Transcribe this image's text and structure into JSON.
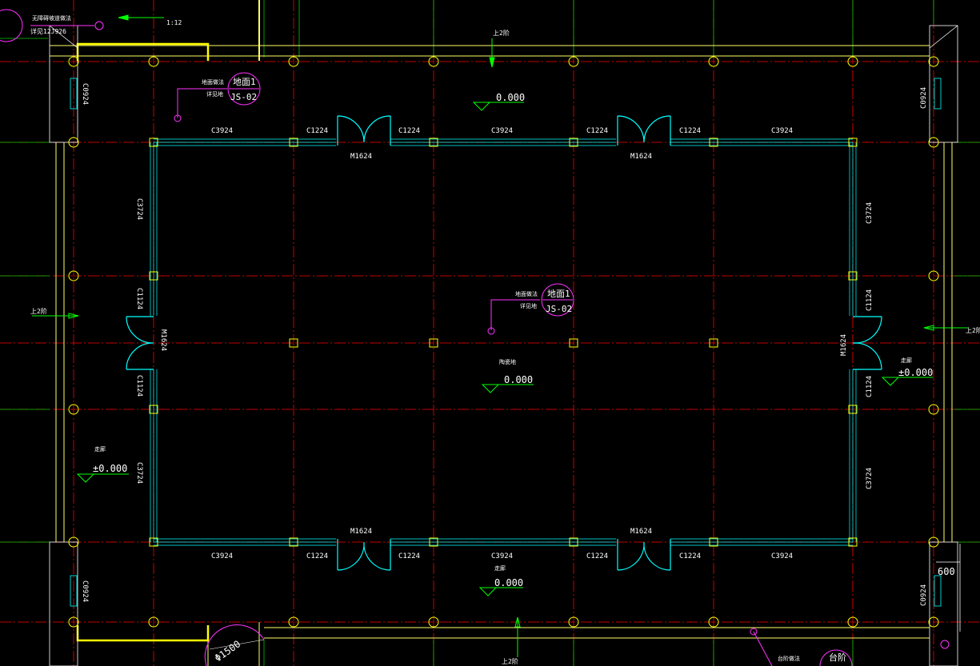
{
  "drawing": {
    "background": "#000000",
    "colors": {
      "axis": "#ff0000",
      "grid_green": "#00c800",
      "wall": "#00ffff",
      "outline": "#ffff66",
      "column": "#ffff00",
      "marker": "#ff33ff",
      "arrow": "#00ff00",
      "white": "#ffffff"
    }
  },
  "top_left_note": {
    "line1": "无障碍坡道做法",
    "line2": "详见12J926",
    "ratio": "1:12"
  },
  "floor_tags": [
    {
      "line1": "地面做法",
      "line2": "详见地",
      "tag": "地面1",
      "code": "JS-02"
    },
    {
      "line1": "地面做法",
      "line2": "详见地",
      "tag": "地面1",
      "code": "JS-02"
    }
  ],
  "level_marks": {
    "top": {
      "label": "",
      "value": "0.000"
    },
    "center": {
      "label": "陶瓷地",
      "value": "0.000"
    },
    "left": {
      "label": "走廊",
      "value": "±0.000"
    },
    "right": {
      "label": "走廊",
      "value": "±0.000"
    },
    "bottom": {
      "label": "走廊",
      "value": "0.000"
    }
  },
  "windows": {
    "top": [
      "C3924",
      "C1224",
      "C1224",
      "C3924",
      "C1224",
      "C1224",
      "C3924"
    ],
    "bottom": [
      "C3924",
      "C1224",
      "C1224",
      "C3924",
      "C1224",
      "C1224",
      "C3924"
    ],
    "left": [
      "C3724",
      "C1124",
      "C1124",
      "C3724"
    ],
    "right": [
      "C3724",
      "C1124",
      "C1124",
      "C3724"
    ],
    "corner": [
      "C0924",
      "C0924",
      "C0924",
      "C0924"
    ]
  },
  "doors": {
    "top": [
      "M1624",
      "M1624"
    ],
    "bottom": [
      "M1624",
      "M1624"
    ],
    "left": "M1624",
    "right": "M1624"
  },
  "stairs": {
    "top": "上2阶",
    "left": "上2阶",
    "right": "上2阶",
    "bottom": "上2阶"
  },
  "dimension": {
    "value": "600"
  },
  "corner_circle": {
    "text": "Φ1500"
  },
  "step_tag": {
    "note": "台阶做法",
    "tag": "台阶"
  }
}
